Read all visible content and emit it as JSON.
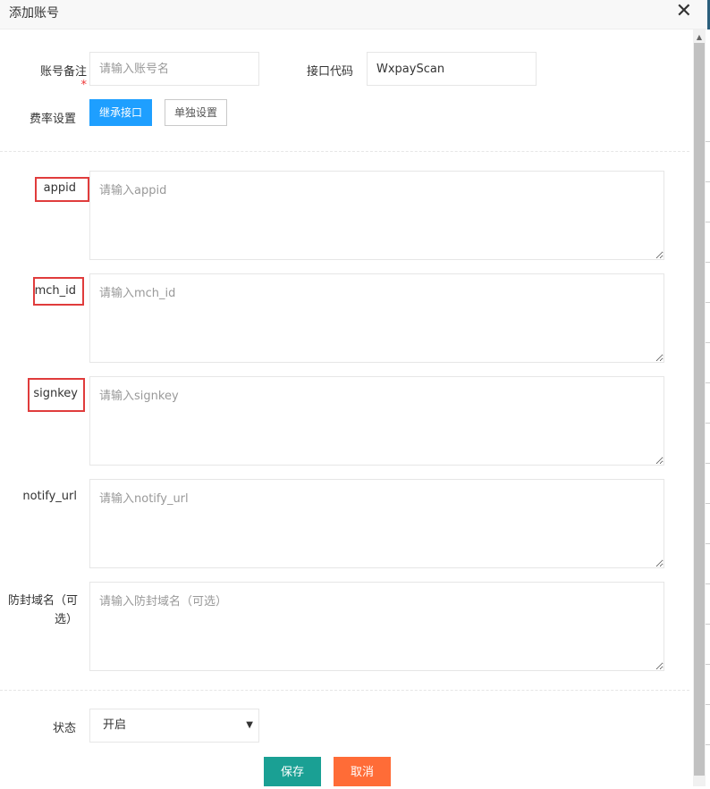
{
  "dialog": {
    "title": "添加账号",
    "close_symbol": "✕"
  },
  "form": {
    "account_note_label": "账号备注",
    "required_mark": "*",
    "account_note_placeholder": "请输入账号名",
    "interface_code_label": "接口代码",
    "interface_code_value": "WxpayScan",
    "rate_label": "费率设置",
    "inherit_button": "继承接口",
    "separate_button": "单独设置",
    "appid_label": "appid",
    "appid_placeholder": "请输入appid",
    "mch_id_label": "mch_id",
    "mch_id_placeholder": "请输入mch_id",
    "signkey_label": "signkey",
    "signkey_placeholder": "请输入signkey",
    "notify_url_label": "notify_url",
    "notify_url_placeholder": "请输入notify_url",
    "domain_label_line1": "防封域名（可",
    "domain_label_line2": "选）",
    "domain_placeholder": "请输入防封域名（可选）",
    "status_label": "状态",
    "status_value": "开启",
    "save_button": "保存",
    "cancel_button": "取消"
  },
  "colors": {
    "primary_blue": "#1e9fff",
    "save_green": "#1aa094",
    "cancel_orange": "#ff6c37",
    "highlight_red": "#e03c3c"
  },
  "icons": {
    "close": "close-icon",
    "dropdown": "chevron-down-icon"
  }
}
